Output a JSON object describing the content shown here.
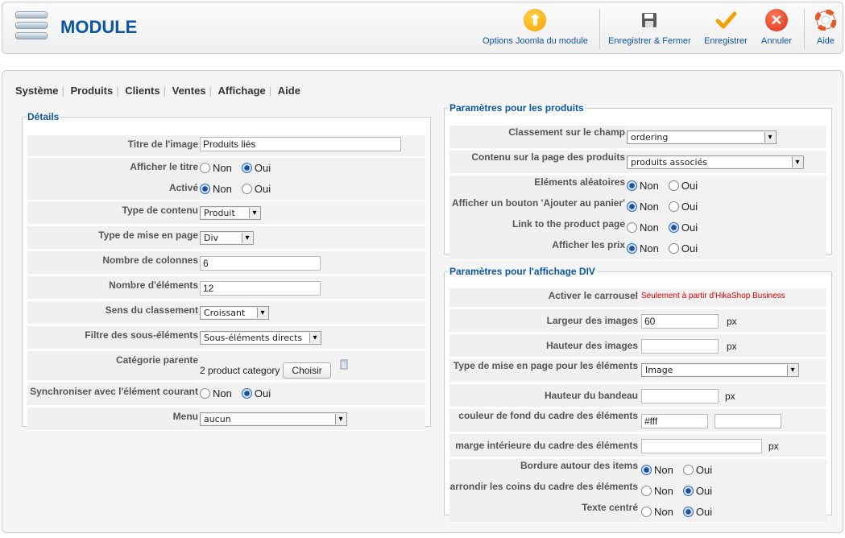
{
  "header": {
    "title": "MODULE",
    "buttons": {
      "options": "Options Joomla du module",
      "save_close": "Enregistrer & Fermer",
      "save": "Enregistrer",
      "cancel": "Annuler",
      "help": "Aide"
    }
  },
  "tabs": [
    "Système",
    "Produits",
    "Clients",
    "Ventes",
    "Affichage",
    "Aide"
  ],
  "details": {
    "legend": "Détails",
    "image_title_label": "Titre de l'image",
    "image_title_value": "Produits liés",
    "show_title_label": "Afficher le titre",
    "active_label": "Activé",
    "content_type_label": "Type de contenu",
    "content_type_value": "Produit",
    "layout_type_label": "Type de mise en page",
    "layout_type_value": "Div",
    "columns_label": "Nombre de colonnes",
    "columns_value": "6",
    "elements_label": "Nombre d'éléments",
    "elements_value": "12",
    "order_dir_label": "Sens du classement",
    "order_dir_value": "Croissant",
    "filter_label": "Filtre des sous-éléments",
    "filter_value": "Sous-éléments directs",
    "parent_label": "Catégorie parente",
    "parent_value": "2 product category",
    "choose_button": "Choisir",
    "sync_label": "Synchroniser avec l'élément courant",
    "menu_label": "Menu",
    "menu_value": "aucun",
    "no": "Non",
    "yes": "Oui"
  },
  "products": {
    "legend": "Paramètres pour les produits",
    "order_field_label": "Classement sur le champ",
    "order_field_value": "ordering",
    "page_content_label": "Contenu sur la page des produits",
    "page_content_value": "produits associés",
    "random_label": "Eléments aléatoires",
    "cart_button_label": "Afficher un bouton 'Ajouter au panier'",
    "link_label": "Link to the product page",
    "prices_label": "Afficher les prix"
  },
  "div": {
    "legend": "Paramètres pour l'affichage DIV",
    "carousel_label": "Activer le carrousel",
    "carousel_note": "Seulement à partir d'HikaShop Business",
    "img_width_label": "Largeur des images",
    "img_width_value": "60",
    "img_height_label": "Hauteur des images",
    "img_height_value": "",
    "layout_label": "Type de mise en page pour les éléments",
    "layout_value": "Image",
    "banner_height_label": "Hauteur du bandeau",
    "bg_color_label": "couleur de fond du cadre des éléments",
    "bg_color_value": "#fff",
    "padding_label": "marge intérieure du cadre des éléments",
    "border_label": "Bordure autour des items",
    "rounded_label": "arrondir les coins du cadre des éléments",
    "centered_label": "Texte centré",
    "unit": "px"
  },
  "colors": {
    "accent": "#0b55a4",
    "options_icon": "#f5a000",
    "cancel_icon": "#e8401f",
    "save_check": "#f29f05"
  }
}
